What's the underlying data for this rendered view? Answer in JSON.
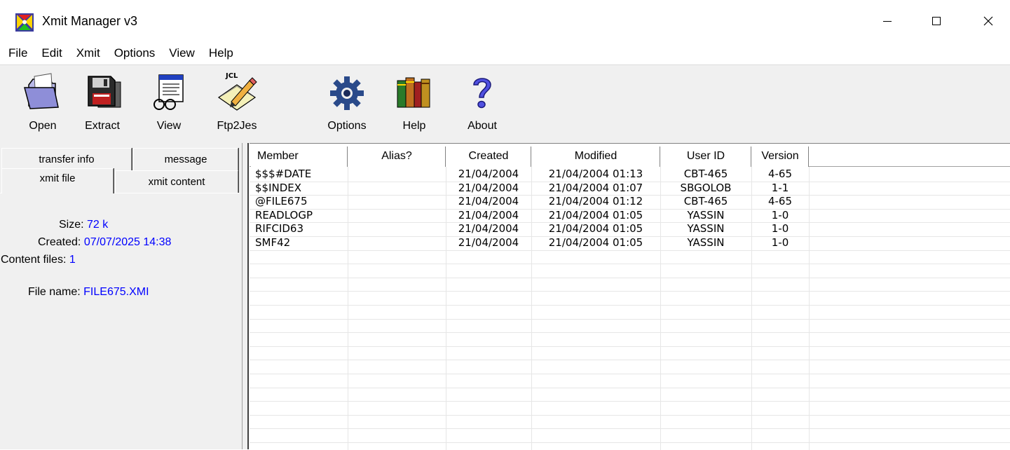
{
  "window": {
    "title": "Xmit Manager  v3",
    "controls": {
      "minimize": "—",
      "maximize": "☐",
      "close": "✕"
    }
  },
  "menu": [
    "File",
    "Edit",
    "Xmit",
    "Options",
    "View",
    "Help"
  ],
  "toolbar": {
    "open": "Open",
    "extract": "Extract",
    "view": "View",
    "ftp2jes": "Ftp2Jes",
    "ftp2jes_badge": "JCL",
    "options": "Options",
    "help": "Help",
    "about": "About",
    "icons": {
      "open": "folder-icon",
      "extract": "floppy-disk-icon",
      "view": "document-glasses-icon",
      "ftp2jes": "jcl-pencil-icon",
      "options": "gear-icon",
      "help": "books-icon",
      "about": "question-mark-icon"
    }
  },
  "tabs": {
    "transfer_info": "transfer info",
    "message": "message",
    "xmit_file": "xmit file",
    "xmit_content": "xmit content"
  },
  "file_info": {
    "size_label": "Size:",
    "size_value": "72 k",
    "created_label": "Created:",
    "created_value": "07/07/2025  14:38",
    "content_files_label": "Content files:",
    "content_files_value": "1",
    "file_name_label": "File name:",
    "file_name_value": "FILE675.XMI"
  },
  "members_table": {
    "columns": [
      "Member",
      "Alias?",
      "Created",
      "Modified",
      "User ID",
      "Version"
    ],
    "rows": [
      [
        "$$$#DATE",
        "",
        "21/04/2004",
        "21/04/2004  01:13",
        "CBT-465",
        "4-65"
      ],
      [
        "$$INDEX",
        "",
        "21/04/2004",
        "21/04/2004  01:07",
        "SBGOLOB",
        "1-1"
      ],
      [
        "@FILE675",
        "",
        "21/04/2004",
        "21/04/2004  01:12",
        "CBT-465",
        "4-65"
      ],
      [
        "READLOGP",
        "",
        "21/04/2004",
        "21/04/2004  01:05",
        "YASSIN",
        "1-0"
      ],
      [
        "RIFCID63",
        "",
        "21/04/2004",
        "21/04/2004  01:05",
        "YASSIN",
        "1-0"
      ],
      [
        "SMF42",
        "",
        "21/04/2004",
        "21/04/2004  01:05",
        "YASSIN",
        "1-0"
      ]
    ]
  },
  "colors": {
    "accent_value": "#0000ff",
    "chrome": "#f0f0f0",
    "grid": "#e6e6e6"
  }
}
